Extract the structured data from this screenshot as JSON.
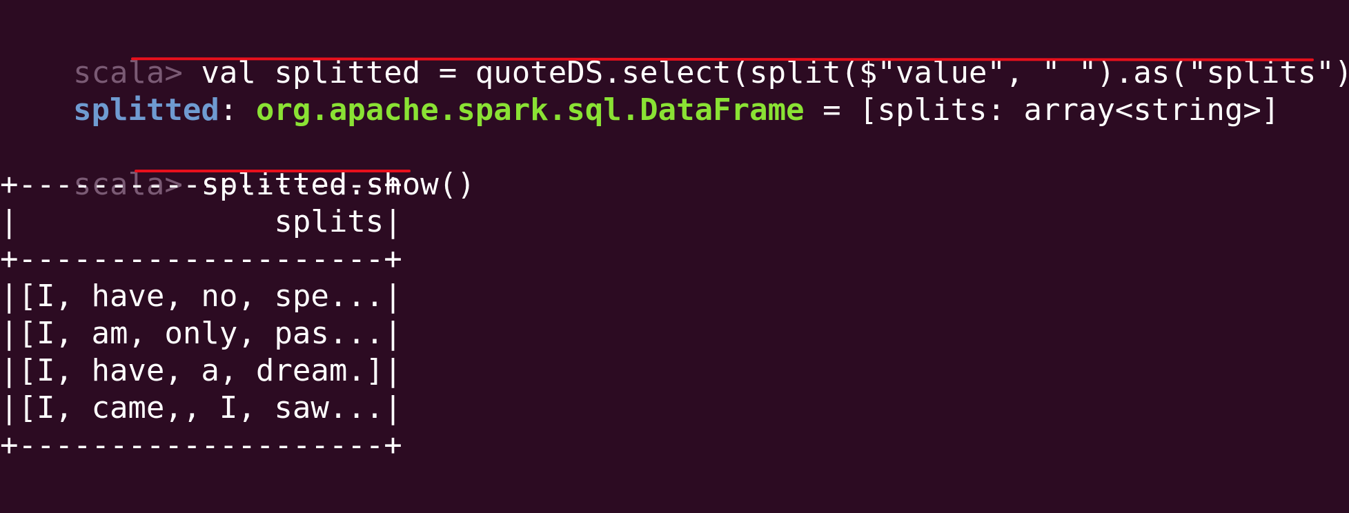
{
  "terminal": {
    "prompt": "scala> ",
    "command1": "val splitted = quoteDS.select(split($\"value\", \" \").as(\"splits\"))",
    "result1": {
      "name": "splitted",
      "separator": ": ",
      "type": "org.apache.spark.sql.DataFrame",
      "rest": " = [splits: array<string>]"
    },
    "command2": "splitted.show()",
    "table": {
      "border": "+--------------------+",
      "header": "|              splits|",
      "rows": [
        "|[I, have, no, spe...|",
        "|[I, am, only, pas...|",
        "|[I, have, a, dream.]|",
        "|[I, came,, I, saw...|"
      ]
    },
    "colors": {
      "background": "#2c0b22",
      "prompt": "#7a5a74",
      "variable": "#6f9bd1",
      "type": "#8ae234",
      "annotation": "#e8101c"
    }
  }
}
